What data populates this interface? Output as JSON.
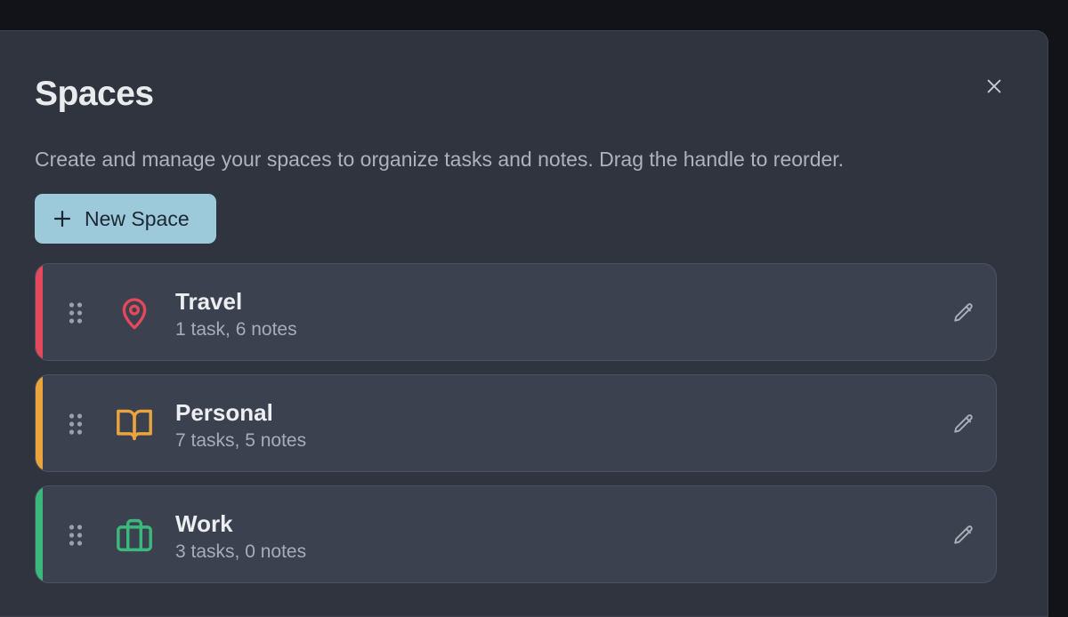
{
  "modal": {
    "title": "Spaces",
    "subtitle": "Create and manage your spaces to organize tasks and notes. Drag the handle to reorder.",
    "close_icon": "close-icon"
  },
  "new_space_button": {
    "label": "New Space",
    "icon": "plus-icon",
    "color": "#9ccadb"
  },
  "spaces": [
    {
      "name": "Travel",
      "meta": "1 task, 6 notes",
      "icon": "map-pin-icon",
      "color": "#e5485a"
    },
    {
      "name": "Personal",
      "meta": "7 tasks, 5 notes",
      "icon": "book-open-icon",
      "color": "#e9a43b"
    },
    {
      "name": "Work",
      "meta": "3 tasks, 0 notes",
      "icon": "briefcase-icon",
      "color": "#3bb97c"
    }
  ]
}
